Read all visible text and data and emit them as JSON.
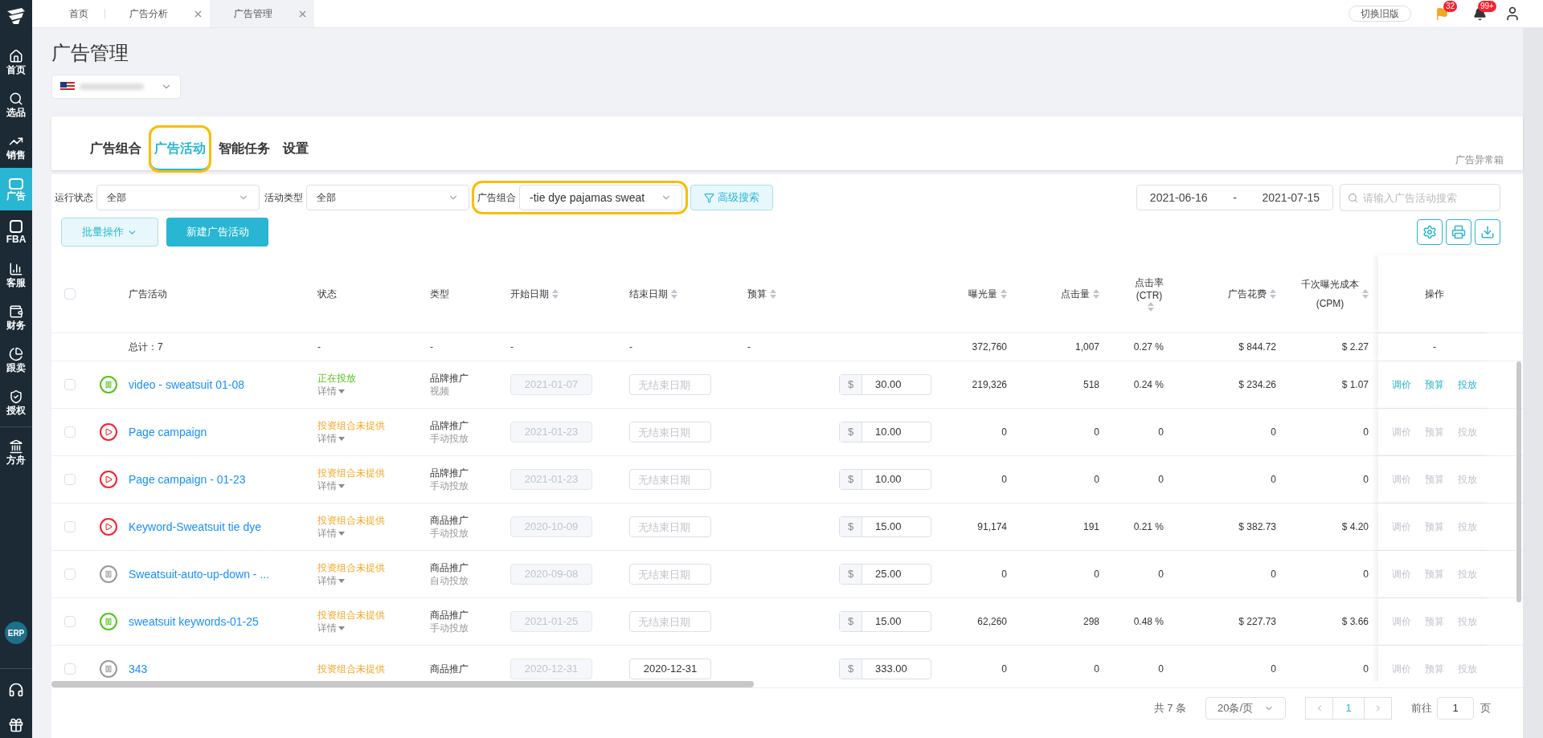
{
  "top_tabs": [
    {
      "label": "首页",
      "closable": false,
      "selected": false
    },
    {
      "label": "广告分析",
      "closable": true,
      "selected": false
    },
    {
      "label": "广告管理",
      "closable": true,
      "selected": true
    }
  ],
  "top_right": {
    "switch_button": "切换旧版",
    "flag_badge": "32",
    "bell_badge": "99+"
  },
  "sidebar": {
    "items": [
      {
        "label": "首页",
        "selected": false
      },
      {
        "label": "选品",
        "selected": false
      },
      {
        "label": "销售",
        "selected": false
      },
      {
        "label": "广告",
        "selected": true
      },
      {
        "label": "FBA",
        "selected": false
      },
      {
        "label": "客服",
        "selected": false
      },
      {
        "label": "财务",
        "selected": false
      },
      {
        "label": "跟卖",
        "selected": false
      },
      {
        "label": "授权",
        "selected": false
      },
      {
        "label": "方舟",
        "selected": false
      }
    ],
    "erp": "ERP"
  },
  "page_title": "广告管理",
  "section_tabs": [
    {
      "label": "广告组合",
      "selected": false,
      "highlighted": false
    },
    {
      "label": "广告活动",
      "selected": true,
      "highlighted": true
    },
    {
      "label": "智能任务",
      "selected": false,
      "highlighted": false
    },
    {
      "label": "设置",
      "selected": false,
      "highlighted": false
    }
  ],
  "anomaly_link": "广告异常箱",
  "filters": [
    {
      "label": "运行状态",
      "value": "全部",
      "highlighted": false
    },
    {
      "label": "活动类型",
      "value": "全部",
      "highlighted": false
    },
    {
      "label": "广告组合",
      "value": "-tie dye pajamas sweat",
      "highlighted": true
    }
  ],
  "advanced_search": "高级搜索",
  "date_range": {
    "start": "2021-06-16",
    "separator": "-",
    "end": "2021-07-15"
  },
  "search": {
    "placeholder": "请输入广告活动搜索"
  },
  "batch_button": "批量操作",
  "new_button": "新建广告活动",
  "select_all_checked": false,
  "columns": [
    {
      "label": "广告活动",
      "sortable": false
    },
    {
      "label": "状态",
      "sortable": false
    },
    {
      "label": "类型",
      "sortable": false
    },
    {
      "label": "开始日期",
      "sortable": true
    },
    {
      "label": "结束日期",
      "sortable": true
    },
    {
      "label": "预算",
      "sortable": true
    },
    {
      "label": "曝光量",
      "sortable": true
    },
    {
      "label": "点击量",
      "sortable": true
    },
    {
      "label": "点击率",
      "sublabel": "(CTR)",
      "sortable": true
    },
    {
      "label": "广告花费",
      "sortable": true
    },
    {
      "label": "千次曝光成本",
      "sublabel": "(CPM)",
      "sortable": true
    },
    {
      "label": "操作",
      "sortable": false
    }
  ],
  "total_row": [
    "总计：7",
    "-",
    "-",
    "-",
    "-",
    "-",
    "372,760",
    "1,007",
    "0.27 %",
    "$ 844.72",
    "$ 2.27",
    "-"
  ],
  "rows": [
    {
      "checked": false,
      "kind": "pause",
      "color": "#52c41a",
      "name": "video - sweatsuit 01-08",
      "status": "正在投放",
      "status_active": true,
      "detail": "详情",
      "type": "品牌推广",
      "subtype": "视频",
      "start": "2021-01-07",
      "end_placeholder": "无结束日期",
      "currency": "$",
      "budget": "30.00",
      "impressions": "219,326",
      "clicks": "518",
      "ctr": "0.24 %",
      "spend": "$ 234.26",
      "cpm": "$ 1.07",
      "actions": [
        "调价",
        "预算",
        "投放"
      ],
      "actions_disabled": false
    },
    {
      "checked": false,
      "kind": "play",
      "color": "#f5222d",
      "name": "Page campaign",
      "status": "投资组合未提供",
      "status_active": false,
      "detail": "详情",
      "type": "品牌推广",
      "subtype": "手动投放",
      "start": "2021-01-23",
      "end_placeholder": "无结束日期",
      "currency": "$",
      "budget": "10.00",
      "impressions": "0",
      "clicks": "0",
      "ctr": "0",
      "spend": "0",
      "cpm": "0",
      "actions": [
        "调价",
        "预算",
        "投放"
      ],
      "actions_disabled": true
    },
    {
      "checked": false,
      "kind": "play",
      "color": "#f5222d",
      "name": "Page campaign - 01-23",
      "status": "投资组合未提供",
      "status_active": false,
      "detail": "详情",
      "type": "品牌推广",
      "subtype": "手动投放",
      "start": "2021-01-23",
      "end_placeholder": "无结束日期",
      "currency": "$",
      "budget": "10.00",
      "impressions": "0",
      "clicks": "0",
      "ctr": "0",
      "spend": "0",
      "cpm": "0",
      "actions": [
        "调价",
        "预算",
        "投放"
      ],
      "actions_disabled": true
    },
    {
      "checked": false,
      "kind": "play",
      "color": "#f5222d",
      "name": "Keyword-Sweatsuit tie dye",
      "status": "投资组合未提供",
      "status_active": false,
      "detail": "详情",
      "type": "商品推广",
      "subtype": "手动投放",
      "start": "2020-10-09",
      "end_placeholder": "无结束日期",
      "currency": "$",
      "budget": "15.00",
      "impressions": "91,174",
      "clicks": "191",
      "ctr": "0.21 %",
      "spend": "$ 382.73",
      "cpm": "$ 4.20",
      "actions": [
        "调价",
        "预算",
        "投放"
      ],
      "actions_disabled": true
    },
    {
      "checked": false,
      "kind": "pause",
      "color": "#999999",
      "name": "Sweatsuit-auto-up-down - ...",
      "status": "投资组合未提供",
      "status_active": false,
      "detail": "详情",
      "type": "商品推广",
      "subtype": "自动投放",
      "start": "2020-09-08",
      "end_placeholder": "无结束日期",
      "currency": "$",
      "budget": "25.00",
      "impressions": "0",
      "clicks": "0",
      "ctr": "0",
      "spend": "0",
      "cpm": "0",
      "actions": [
        "调价",
        "预算",
        "投放"
      ],
      "actions_disabled": true
    },
    {
      "checked": false,
      "kind": "pause",
      "color": "#52c41a",
      "name": "sweatsuit keywords-01-25",
      "status": "投资组合未提供",
      "status_active": false,
      "detail": "详情",
      "type": "商品推广",
      "subtype": "手动投放",
      "start": "2021-01-25",
      "end_placeholder": "无结束日期",
      "currency": "$",
      "budget": "15.00",
      "impressions": "62,260",
      "clicks": "298",
      "ctr": "0.48 %",
      "spend": "$ 227.73",
      "cpm": "$ 3.66",
      "actions": [
        "调价",
        "预算",
        "投放"
      ],
      "actions_disabled": true
    },
    {
      "checked": false,
      "kind": "pause",
      "color": "#999999",
      "name": "343",
      "status": "投资组合未提供",
      "status_active": false,
      "type": "商品推广",
      "start": "2020-12-31",
      "end": "2020-12-31",
      "currency": "$",
      "budget": "333.00",
      "impressions": "0",
      "clicks": "0",
      "ctr": "0",
      "spend": "0",
      "cpm": "0",
      "actions": [
        "调价",
        "预算",
        "投放"
      ],
      "actions_disabled": true
    }
  ],
  "pagination": {
    "total": "共 7 条",
    "page_size": "20条/页",
    "pages": [
      {
        "label": "1",
        "selected": true
      }
    ],
    "goto_label": "前往",
    "goto_value": "1",
    "goto_suffix": "页"
  }
}
